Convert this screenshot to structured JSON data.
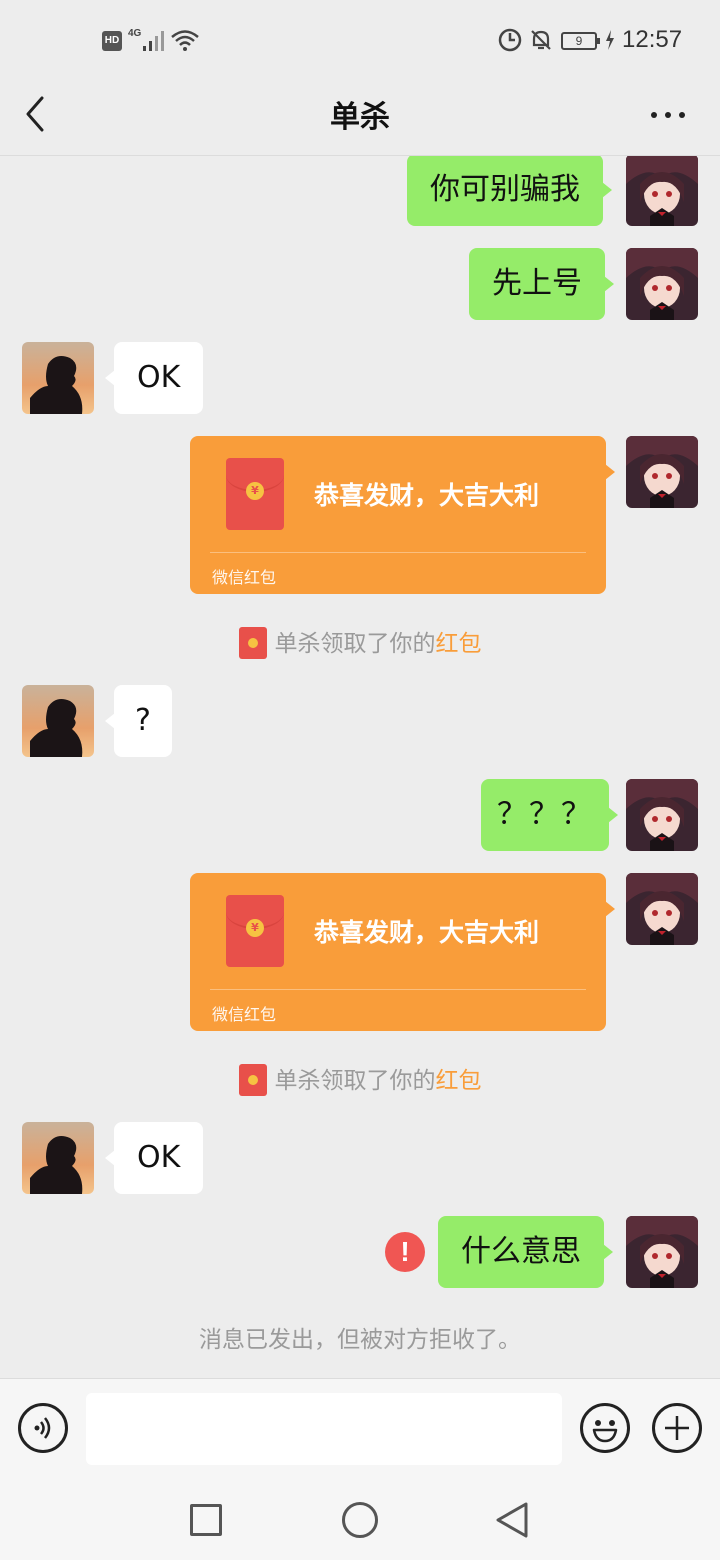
{
  "status_bar": {
    "hd_label": "HD",
    "network_label": "4G",
    "battery_level": "9",
    "time": "12:57"
  },
  "header": {
    "title": "单杀",
    "back_icon": "chevron-left-icon",
    "more_icon": "more-dots-icon"
  },
  "messages": [
    {
      "sender": "me",
      "type": "text",
      "text": "你可别骗我"
    },
    {
      "sender": "me",
      "type": "text",
      "text": "先上号"
    },
    {
      "sender": "them",
      "type": "text",
      "text": "OK"
    },
    {
      "sender": "me",
      "type": "red_packet",
      "blessing": "恭喜发财，大吉大利",
      "label": "微信红包"
    },
    {
      "sender": "system",
      "type": "notice",
      "prefix": "单杀领取了你的",
      "link": "红包"
    },
    {
      "sender": "them",
      "type": "text",
      "text": "?"
    },
    {
      "sender": "me",
      "type": "text",
      "text": "？？？"
    },
    {
      "sender": "me",
      "type": "red_packet",
      "blessing": "恭喜发财，大吉大利",
      "label": "微信红包"
    },
    {
      "sender": "system",
      "type": "notice",
      "prefix": "单杀领取了你的",
      "link": "红包"
    },
    {
      "sender": "them",
      "type": "text",
      "text": "OK"
    },
    {
      "sender": "me",
      "type": "text",
      "text": "什么意思",
      "status": "failed",
      "error_icon": "exclamation-icon"
    },
    {
      "sender": "system",
      "type": "notice",
      "text": "消息已发出，但被对方拒收了。"
    }
  ],
  "input_bar": {
    "voice_icon": "voice-icon",
    "input_value": "",
    "emoji_icon": "emoji-icon",
    "plus_icon": "plus-icon"
  },
  "nav_bar": {
    "recent_icon": "square-icon",
    "home_icon": "circle-icon",
    "back_icon": "triangle-back-icon"
  },
  "colors": {
    "background": "#ededed",
    "my_bubble": "#95ec69",
    "their_bubble": "#ffffff",
    "red_packet": "#f99d3a",
    "error": "#f05653"
  }
}
